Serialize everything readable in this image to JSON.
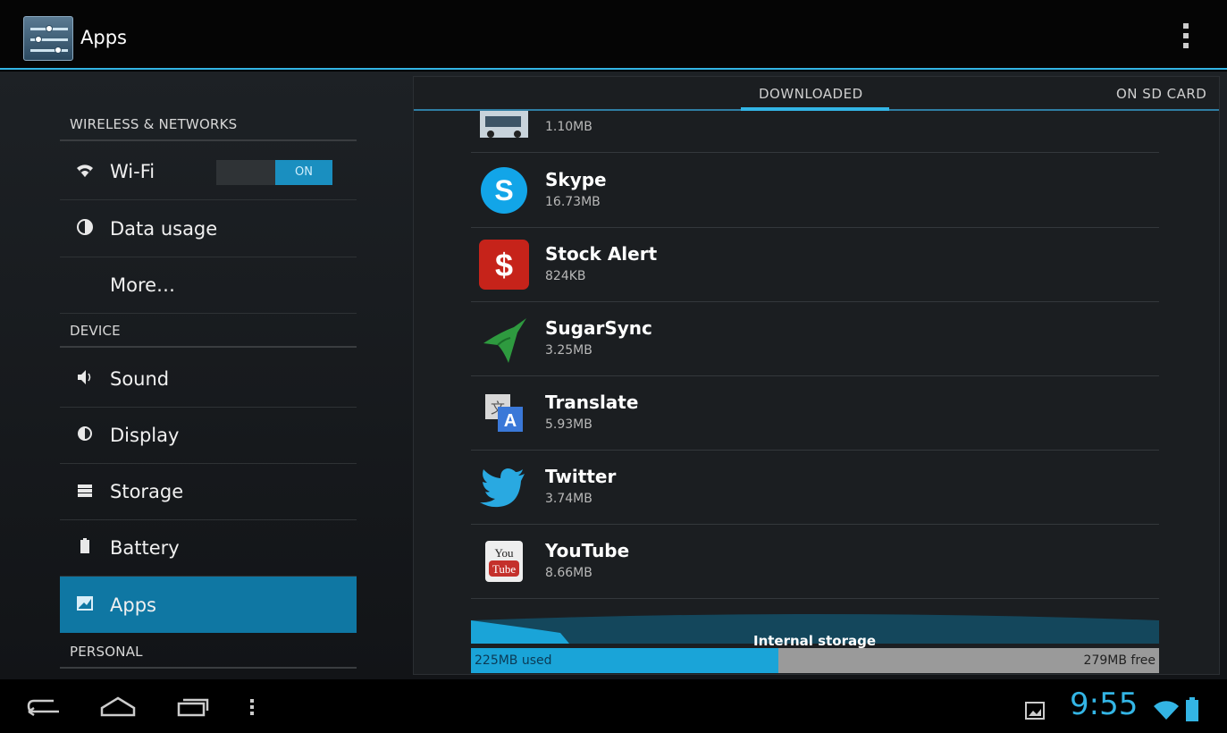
{
  "action_bar": {
    "title": "Apps",
    "menu_icon": "overflow-menu-icon",
    "app_icon": "settings-sliders-icon"
  },
  "sidebar": {
    "sections": [
      {
        "header": "WIRELESS & NETWORKS"
      },
      {
        "header": "DEVICE"
      },
      {
        "header": "PERSONAL"
      }
    ],
    "items": [
      {
        "label": "Wi-Fi",
        "icon": "wifi-icon",
        "toggle": "ON"
      },
      {
        "label": "Data usage",
        "icon": "data-usage-icon"
      },
      {
        "label": "More…",
        "icon": ""
      },
      {
        "label": "Sound",
        "icon": "speaker-icon"
      },
      {
        "label": "Display",
        "icon": "display-icon"
      },
      {
        "label": "Storage",
        "icon": "storage-icon"
      },
      {
        "label": "Battery",
        "icon": "battery-icon"
      },
      {
        "label": "Apps",
        "icon": "apps-icon",
        "selected": true
      }
    ]
  },
  "tabs": [
    {
      "label": "DOWNLOADED",
      "active": true
    },
    {
      "label": "ON SD CARD",
      "active": false
    }
  ],
  "apps": [
    {
      "name": "",
      "size": "1.10MB",
      "icon": "car-app-icon"
    },
    {
      "name": "Skype",
      "size": "16.73MB",
      "icon": "skype-icon"
    },
    {
      "name": "Stock Alert",
      "size": "824KB",
      "icon": "stock-alert-icon"
    },
    {
      "name": "SugarSync",
      "size": "3.25MB",
      "icon": "sugarsync-icon"
    },
    {
      "name": "Translate",
      "size": "5.93MB",
      "icon": "translate-icon"
    },
    {
      "name": "Twitter",
      "size": "3.74MB",
      "icon": "twitter-icon"
    },
    {
      "name": "YouTube",
      "size": "8.66MB",
      "icon": "youtube-icon"
    }
  ],
  "storage": {
    "label": "Internal storage",
    "used": "225MB used",
    "free": "279MB free",
    "used_fraction": 0.4464
  },
  "status_bar": {
    "time": "9:55"
  },
  "colors": {
    "accent": "#33b5e5",
    "selected_bg": "#0f77a3"
  }
}
